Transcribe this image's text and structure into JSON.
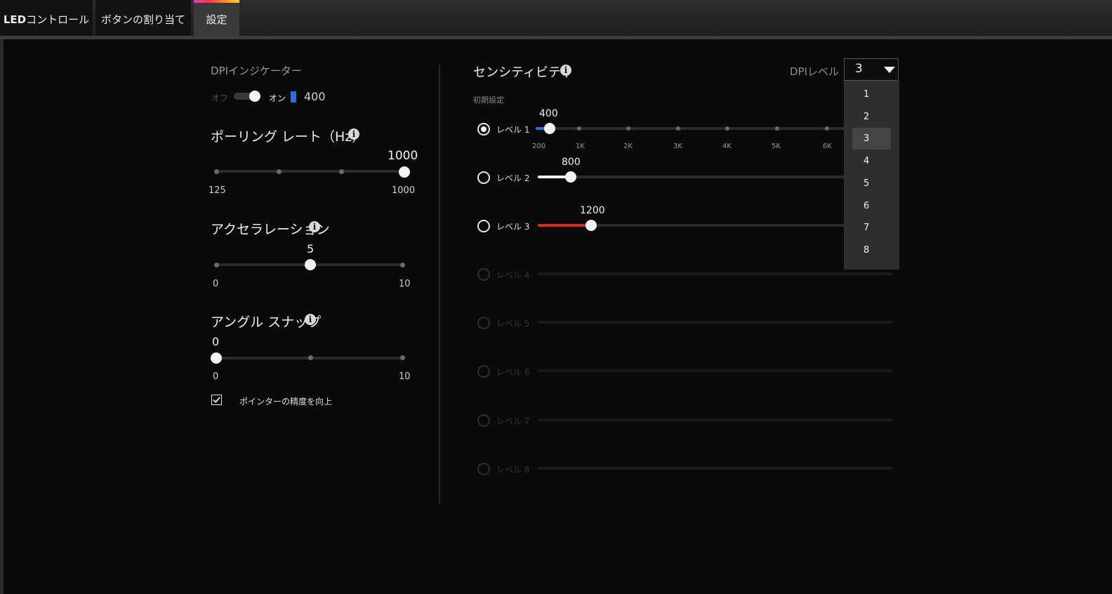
{
  "tabs": [
    {
      "label_bold": "LED",
      "label": "コントロール"
    },
    {
      "label": "ボタンの割り当て"
    },
    {
      "label": "設定"
    }
  ],
  "dpi_indicator": {
    "title": "DPIインジケーター",
    "off_label": "オフ",
    "on_label": "オン",
    "value": "400",
    "color": "#2f6fdc"
  },
  "polling_rate": {
    "title": "ポーリング レート（Hz）",
    "value": "1000",
    "min": "125",
    "max": "1000",
    "position": 1.0
  },
  "acceleration": {
    "title": "アクセラレーション",
    "value": "5",
    "min": "0",
    "max": "10",
    "position": 0.5
  },
  "angle_snap": {
    "title": "アングル スナップ",
    "value": "0",
    "min": "0",
    "max": "10",
    "position": 0.0
  },
  "pointer_precision": {
    "label": "ポインターの精度を向上",
    "checked": true
  },
  "sensitivity": {
    "title": "センシティビティ",
    "subtitle": "初期設定",
    "dpi_level_label": "DPIレベル",
    "dpi_level_value": "3",
    "axis_ticks": [
      "200",
      "1K",
      "2K",
      "3K",
      "4K",
      "5K",
      "6K"
    ],
    "levels": [
      {
        "label": "レベル 1",
        "value": "400",
        "color": "#2f6fdc",
        "active": true,
        "selected": true
      },
      {
        "label": "レベル 2",
        "value": "800",
        "color": "#f2f2f2",
        "active": true,
        "selected": false
      },
      {
        "label": "レベル 3",
        "value": "1200",
        "color": "#d42b2b",
        "active": true,
        "selected": false
      },
      {
        "label": "レベル 4",
        "active": false
      },
      {
        "label": "レベル 5",
        "active": false
      },
      {
        "label": "レベル 6",
        "active": false
      },
      {
        "label": "レベル 7",
        "active": false
      },
      {
        "label": "レベル 8",
        "active": false
      }
    ]
  },
  "dpi_dropdown": {
    "options": [
      "1",
      "2",
      "3",
      "4",
      "5",
      "6",
      "7",
      "8"
    ],
    "selected": "3"
  }
}
